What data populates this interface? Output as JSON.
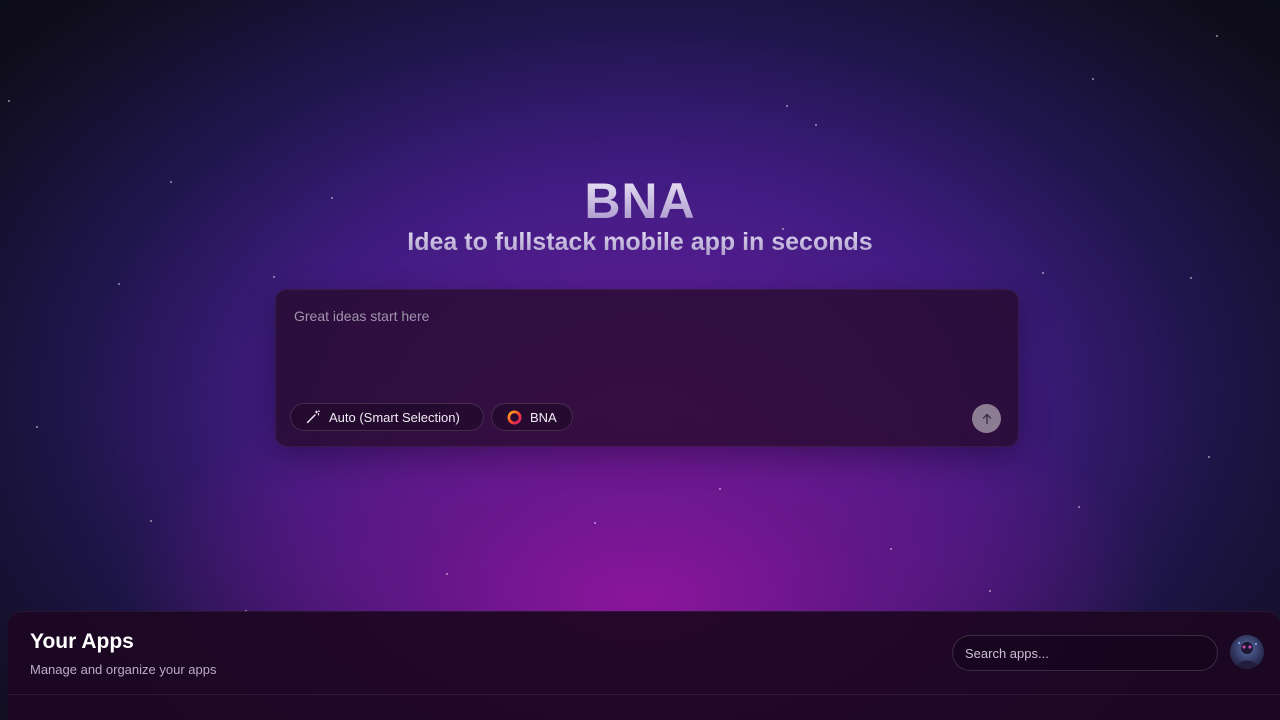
{
  "hero": {
    "title": "BNA",
    "subtitle": "Idea to fullstack mobile app in seconds"
  },
  "prompt": {
    "placeholder": "Great ideas start here",
    "model_chip_label": "Auto (Smart Selection)",
    "model_chip_icon": "magic-wand-icon",
    "brand_chip_label": "BNA",
    "brand_chip_icon": "bna-logo-icon",
    "send_icon": "arrow-up-icon"
  },
  "apps": {
    "title": "Your Apps",
    "subtitle": "Manage and organize your apps",
    "search_placeholder": "Search apps..."
  },
  "colors": {
    "accent_purple": "#7a1a9a",
    "panel_bg": "#1c0622",
    "send_button": "#8c7d94"
  }
}
